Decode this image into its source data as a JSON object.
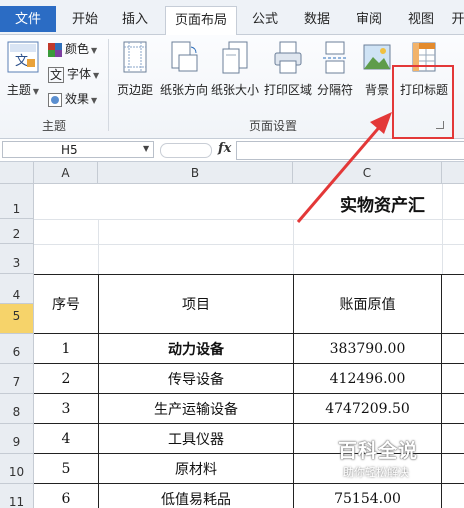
{
  "ribbon_tabs": [
    {
      "label": "文件"
    },
    {
      "label": "开始"
    },
    {
      "label": "插入"
    },
    {
      "label": "页面布局"
    },
    {
      "label": "公式"
    },
    {
      "label": "数据"
    },
    {
      "label": "审阅"
    },
    {
      "label": "视图"
    },
    {
      "label": "开"
    }
  ],
  "theme_group": {
    "label": "主题",
    "theme_button": "主题",
    "colors": "颜色",
    "fonts": "字体",
    "effects": "效果",
    "theme_icon_text": "文",
    "fonts_icon_text": "文"
  },
  "page_setup_group": {
    "label": "页面设置",
    "buttons": [
      "页边距",
      "纸张方向",
      "纸张大小",
      "打印区域",
      "分隔符",
      "背景",
      "打印标题"
    ]
  },
  "formula_bar": {
    "name_box": "H5",
    "fx": "fx",
    "value": ""
  },
  "columns": [
    "A",
    "B",
    "C"
  ],
  "rows": [
    "1",
    "2",
    "3",
    "4",
    "5",
    "6",
    "7",
    "8",
    "9",
    "10",
    "11"
  ],
  "sheet": {
    "title": "实物资产汇",
    "headers": {
      "a": "序号",
      "b": "项目",
      "c": "账面原值"
    },
    "data_rows": [
      {
        "no": "1",
        "item": "动力设备",
        "value": "383790.00",
        "bold": true
      },
      {
        "no": "2",
        "item": "传导设备",
        "value": "412496.00"
      },
      {
        "no": "3",
        "item": "生产运输设备",
        "value": "4747209.50"
      },
      {
        "no": "4",
        "item": "工具仪器",
        "value": ""
      },
      {
        "no": "5",
        "item": "原材料",
        "value": ""
      },
      {
        "no": "6",
        "item": "低值易耗品",
        "value": "75154.00"
      }
    ]
  },
  "watermark": {
    "title": "百科全说",
    "subtitle": "助你轻松解决"
  },
  "colors": {
    "file_tab": "#2b6cc4",
    "highlight": "#e33838",
    "selected_row": "#f6d36a"
  }
}
